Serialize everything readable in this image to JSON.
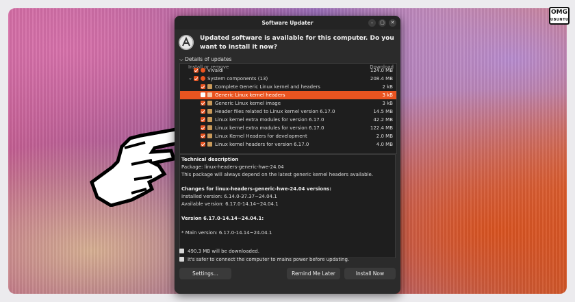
{
  "brand_logo": {
    "line1": "OMG",
    "line2": "UBUNTU"
  },
  "window": {
    "title": "Software Updater",
    "controls": {
      "minimize": "–",
      "maximize": "▢",
      "close": "✕"
    }
  },
  "header": {
    "message": "Updated software is available for this computer. Do you want to install it now?"
  },
  "details": {
    "toggle_label": "Details of updates",
    "columns": {
      "name": "Install or remove",
      "size": "Download"
    },
    "rows": [
      {
        "name": "Vivaldi",
        "size": "124.0 MB",
        "checked": true
      },
      {
        "name": "System components (13)",
        "size": "208.4 MB",
        "checked": true,
        "group": true
      },
      {
        "name": "Complete Generic Linux kernel and headers",
        "size": "2 kB",
        "checked": true
      },
      {
        "name": "Generic Linux kernel headers",
        "size": "3 kB",
        "checked": true,
        "selected": true
      },
      {
        "name": "Generic Linux kernel image",
        "size": "3 kB",
        "checked": true
      },
      {
        "name": "Header files related to Linux kernel version 6.17.0",
        "size": "14.5 MB",
        "checked": true
      },
      {
        "name": "Linux kernel extra modules for version 6.17.0",
        "size": "42.2 MB",
        "checked": true
      },
      {
        "name": "Linux kernel extra modules for version 6.17.0",
        "size": "122.4 MB",
        "checked": true
      },
      {
        "name": "Linux Kernel Headers for development",
        "size": "2.0 MB",
        "checked": true
      },
      {
        "name": "Linux kernel headers for version 6.17.0",
        "size": "4.0 MB",
        "checked": true
      }
    ]
  },
  "description": {
    "heading": "Technical description",
    "package": "Package: linux-headers-generic-hwe-24.04",
    "summary": "This package will always depend on the latest generic kernel headers available.",
    "changes_heading": "Changes for linux-headers-generic-hwe-24.04 versions:",
    "installed": "Installed version: 6.14.0-37.37~24.04.1",
    "available": "Available version: 6.17.0-14.14~24.04.1",
    "version_heading": "Version 6.17.0-14.14~24.04.1:",
    "main_version": "* Main version: 6.17.0-14.14~24.04.1"
  },
  "info": {
    "download_size": "490.3 MB will be downloaded.",
    "power_note": "It's safer to connect the computer to mains power before updating."
  },
  "buttons": {
    "settings": "Settings...",
    "remind": "Remind Me Later",
    "install": "Install Now"
  }
}
